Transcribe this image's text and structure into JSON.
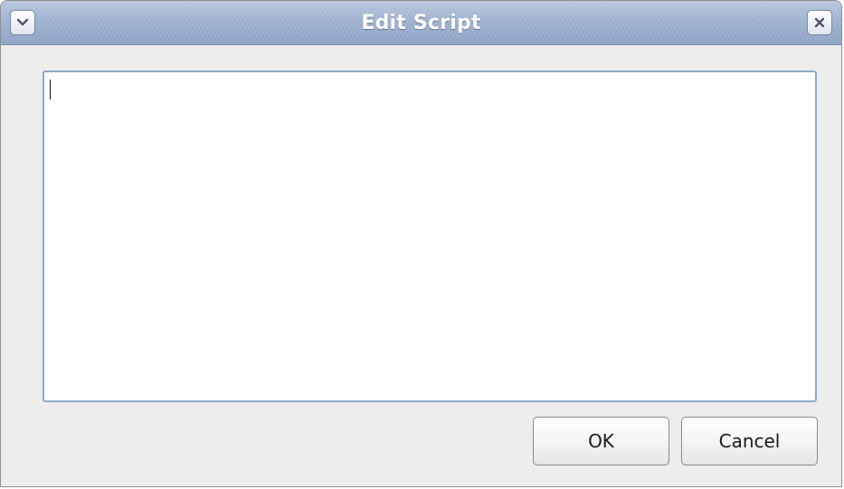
{
  "window": {
    "title": "Edit Script",
    "menu_icon": "chevron-down-icon",
    "close_icon": "close-icon"
  },
  "editor": {
    "value": ""
  },
  "buttons": {
    "ok_label": "OK",
    "cancel_label": "Cancel"
  },
  "colors": {
    "titlebar": "#9eb1cf",
    "editor_border": "#8fa8c6",
    "window_bg": "#ededed"
  }
}
